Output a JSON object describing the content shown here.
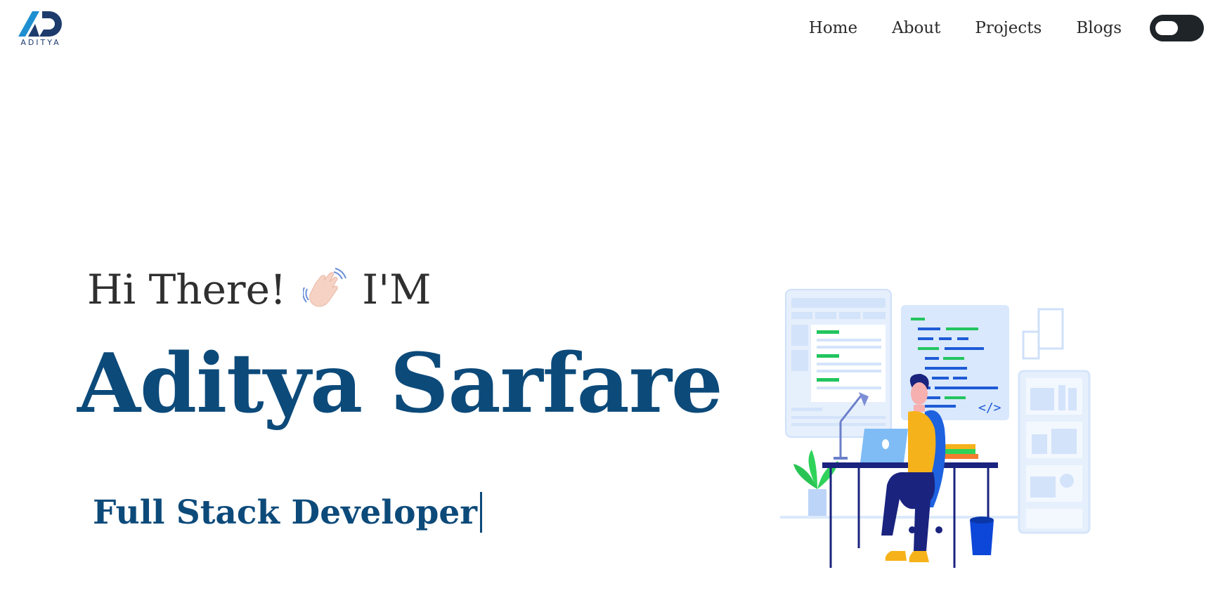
{
  "header": {
    "logo_text": "ADITYA",
    "nav": {
      "home": "Home",
      "about": "About",
      "projects": "Projects",
      "blogs": "Blogs"
    },
    "theme_toggle_icon": "toggle-switch-icon"
  },
  "hero": {
    "greeting_before": "Hi There!",
    "greeting_after": "I'M",
    "wave_icon": "waving-hand-icon",
    "name": "Aditya Sarfare",
    "role": "Full Stack Developer"
  },
  "colors": {
    "primary": "#0c4a7a",
    "text": "#2f2f2f",
    "toggle": "#1f2428",
    "illustration_light": "#dbe9fb",
    "illustration_blue": "#1e5bd6",
    "code_green": "#22c55e",
    "shirt_yellow": "#f6b21a"
  }
}
